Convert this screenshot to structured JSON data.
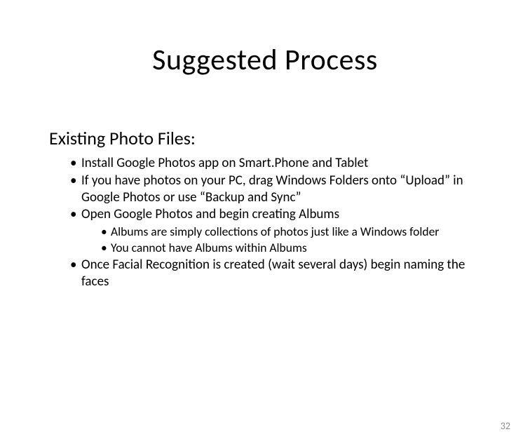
{
  "title": "Suggested Process",
  "section_heading": "Existing Photo Files:",
  "bullets": {
    "b0": "Install Google Photos app on Smart.Phone and Tablet",
    "b1": "If you have photos on your PC, drag Windows Folders onto “Upload” in Google Photos or use “Backup and Sync”",
    "b2": "Open Google Photos and begin creating Albums",
    "b2_sub0": "Albums are simply collections of photos just like a Windows folder",
    "b2_sub1": "You cannot have Albums within Albums",
    "b3": "Once Facial Recognition is created (wait several days) begin naming the faces"
  },
  "page_number": "32"
}
